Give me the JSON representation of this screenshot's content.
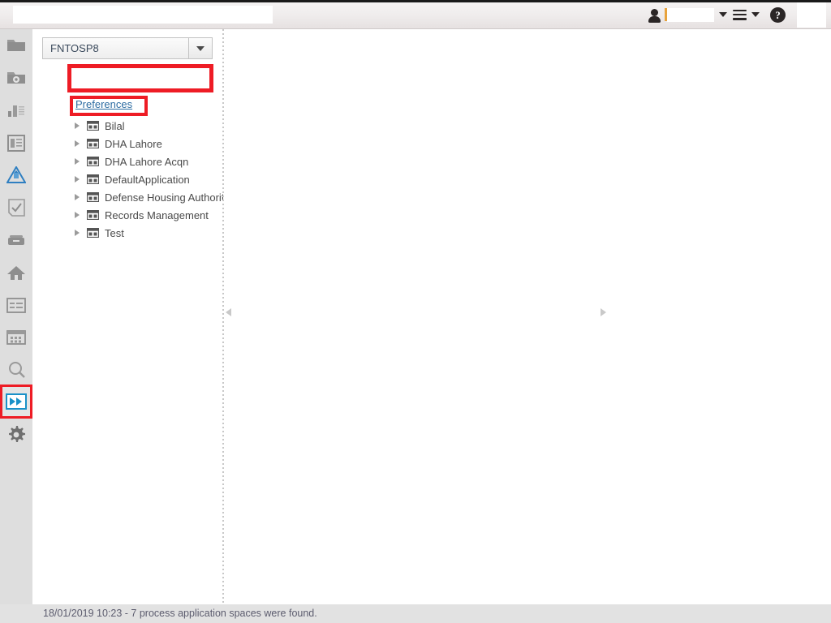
{
  "header": {
    "search_value": "",
    "search_placeholder": "",
    "user_value": "",
    "user_placeholder": "",
    "person_icon": "person-icon",
    "user_dropdown_icon": "chevron-down-icon",
    "menu_icon": "hamburger-menu-icon",
    "menu_dropdown_icon": "chevron-down-icon",
    "help_icon": "help-question-icon",
    "help_glyph": "?"
  },
  "rail": {
    "items": [
      {
        "name": "folder-icon",
        "label": "Folder",
        "selected": false
      },
      {
        "name": "folder-settings-icon",
        "label": "Folder Settings",
        "selected": false
      },
      {
        "name": "bar-chart-icon",
        "label": "Reports",
        "selected": false
      },
      {
        "name": "document-layout-icon",
        "label": "Layout",
        "selected": false
      },
      {
        "name": "recycle-bin-icon",
        "label": "Recycle Bin",
        "selected": false
      },
      {
        "name": "checklist-icon",
        "label": "Tasks",
        "selected": false
      },
      {
        "name": "inbox-tray-icon",
        "label": "Inbox",
        "selected": false
      },
      {
        "name": "home-icon",
        "label": "Home",
        "selected": false
      },
      {
        "name": "form-card-icon",
        "label": "Forms",
        "selected": false
      },
      {
        "name": "calendar-grid-icon",
        "label": "Calendar",
        "selected": false
      },
      {
        "name": "search-magnifier-icon",
        "label": "Search",
        "selected": false
      },
      {
        "name": "fast-forward-icon",
        "label": "Process Applications",
        "selected": true
      },
      {
        "name": "gear-icon",
        "label": "Settings",
        "selected": false
      }
    ]
  },
  "left_panel": {
    "combo_value": "FNTOSP8",
    "combo_dropdown_icon": "chevron-down-icon",
    "preferences_link": "Preferences",
    "tree_items": [
      {
        "label": "Bilal",
        "icon": "application-space-icon"
      },
      {
        "label": "DHA Lahore",
        "icon": "application-space-icon"
      },
      {
        "label": "DHA Lahore Acqn",
        "icon": "application-space-icon"
      },
      {
        "label": "DefaultApplication",
        "icon": "application-space-icon"
      },
      {
        "label": "Defense Housing Authority",
        "icon": "application-space-icon"
      },
      {
        "label": "Records Management",
        "icon": "application-space-icon"
      },
      {
        "label": "Test",
        "icon": "application-space-icon"
      }
    ]
  },
  "splitter": {
    "collapse_left_icon": "triangle-left-icon",
    "expand_right_icon": "triangle-right-icon"
  },
  "statusbar": {
    "text": "18/01/2019 10:23 - 7 process application spaces were found."
  },
  "colors": {
    "annotation_red": "#ee1c25",
    "link_blue": "#2d6ca2",
    "rail_background": "#dedede",
    "statusbar_background": "#e2e2e2",
    "accent_blue": "#1a91c8"
  }
}
